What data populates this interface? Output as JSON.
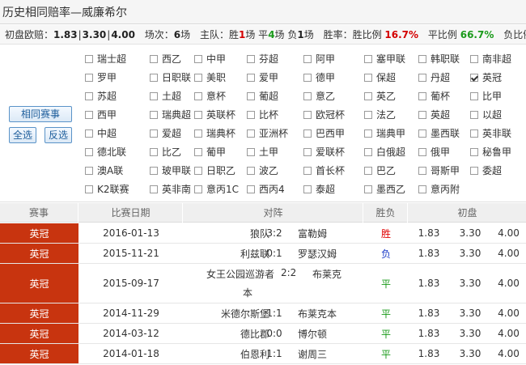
{
  "title": "历史相同赔率—威廉希尔",
  "summary": {
    "odds_label": "初盘欧赔：",
    "odds": [
      "1.83",
      "3.30",
      "4.00"
    ],
    "matches_label": "场次：",
    "matches_value": "6",
    "matches_unit": "场",
    "home_label": "主队：胜",
    "home_win": "1",
    "home_win_unit": "场 平",
    "home_draw": "4",
    "home_draw_unit": "场 负",
    "home_lose": "1",
    "home_lose_unit": "场",
    "win_rate_label": "胜率：胜比例",
    "win_rate": "16.7%",
    "draw_rate_label": "平比例",
    "draw_rate": "66.7%",
    "lose_rate_label": "负比例"
  },
  "buttons": {
    "same_league": "相同赛事",
    "select_all": "全选",
    "invert": "反选"
  },
  "leagues": [
    [
      "瑞士超",
      "西乙",
      "中甲",
      "芬超",
      "阿甲",
      "塞甲联",
      "韩职联",
      "南非超"
    ],
    [
      "罗甲",
      "日职联",
      "美职",
      "爱甲",
      "德甲",
      "保超",
      "丹超",
      "英冠"
    ],
    [
      "苏超",
      "土超",
      "意杯",
      "葡超",
      "意乙",
      "英乙",
      "葡杯",
      "比甲"
    ],
    [
      "西甲",
      "瑞典超",
      "英联杯",
      "比杯",
      "欧冠杯",
      "法乙",
      "英超",
      "以超"
    ],
    [
      "中超",
      "爱超",
      "瑞典杯",
      "亚洲杯",
      "巴西甲",
      "瑞典甲",
      "墨西联",
      "英非联"
    ],
    [
      "德北联",
      "比乙",
      "葡甲",
      "土甲",
      "爱联杯",
      "白俄超",
      "俄甲",
      "秘鲁甲"
    ],
    [
      "澳A联",
      "玻甲联",
      "日职乙",
      "波乙",
      "首长杯",
      "巴乙",
      "哥斯甲",
      "委超"
    ],
    [
      "K2联赛",
      "英非南",
      "意丙1C",
      "西丙4",
      "泰超",
      "墨西乙",
      "意丙附"
    ]
  ],
  "checked_league": "英冠",
  "table": {
    "headers": [
      "赛事",
      "比赛日期",
      "对阵",
      "胜负",
      "初盘"
    ],
    "rows": [
      {
        "league": "英冠",
        "date": "2016-01-13",
        "home": "狼队",
        "score": "3:2",
        "away": "富勒姆",
        "result": "胜",
        "result_type": "win",
        "odds": [
          "1.83",
          "3.30",
          "4.00"
        ]
      },
      {
        "league": "英冠",
        "date": "2015-11-21",
        "home": "利兹联",
        "score": "0:1",
        "away": "罗瑟汉姆",
        "result": "负",
        "result_type": "lose",
        "odds": [
          "1.83",
          "3.30",
          "4.00"
        ]
      },
      {
        "league": "英冠",
        "date": "2015-09-17",
        "home": "女王公园巡游者",
        "score": "2:2",
        "away": "布莱克本",
        "result": "平",
        "result_type": "draw",
        "odds": [
          "1.83",
          "3.30",
          "4.00"
        ]
      },
      {
        "league": "英冠",
        "date": "2014-11-29",
        "home": "米德尔斯堡",
        "score": "1:1",
        "away": "布莱克本",
        "result": "平",
        "result_type": "draw",
        "odds": [
          "1.83",
          "3.30",
          "4.00"
        ]
      },
      {
        "league": "英冠",
        "date": "2014-03-12",
        "home": "德比郡",
        "score": "0:0",
        "away": "博尔顿",
        "result": "平",
        "result_type": "draw",
        "odds": [
          "1.83",
          "3.30",
          "4.00"
        ]
      },
      {
        "league": "英冠",
        "date": "2014-01-18",
        "home": "伯恩利",
        "score": "1:1",
        "away": "谢周三",
        "result": "平",
        "result_type": "draw",
        "odds": [
          "1.83",
          "3.30",
          "4.00"
        ]
      }
    ]
  }
}
